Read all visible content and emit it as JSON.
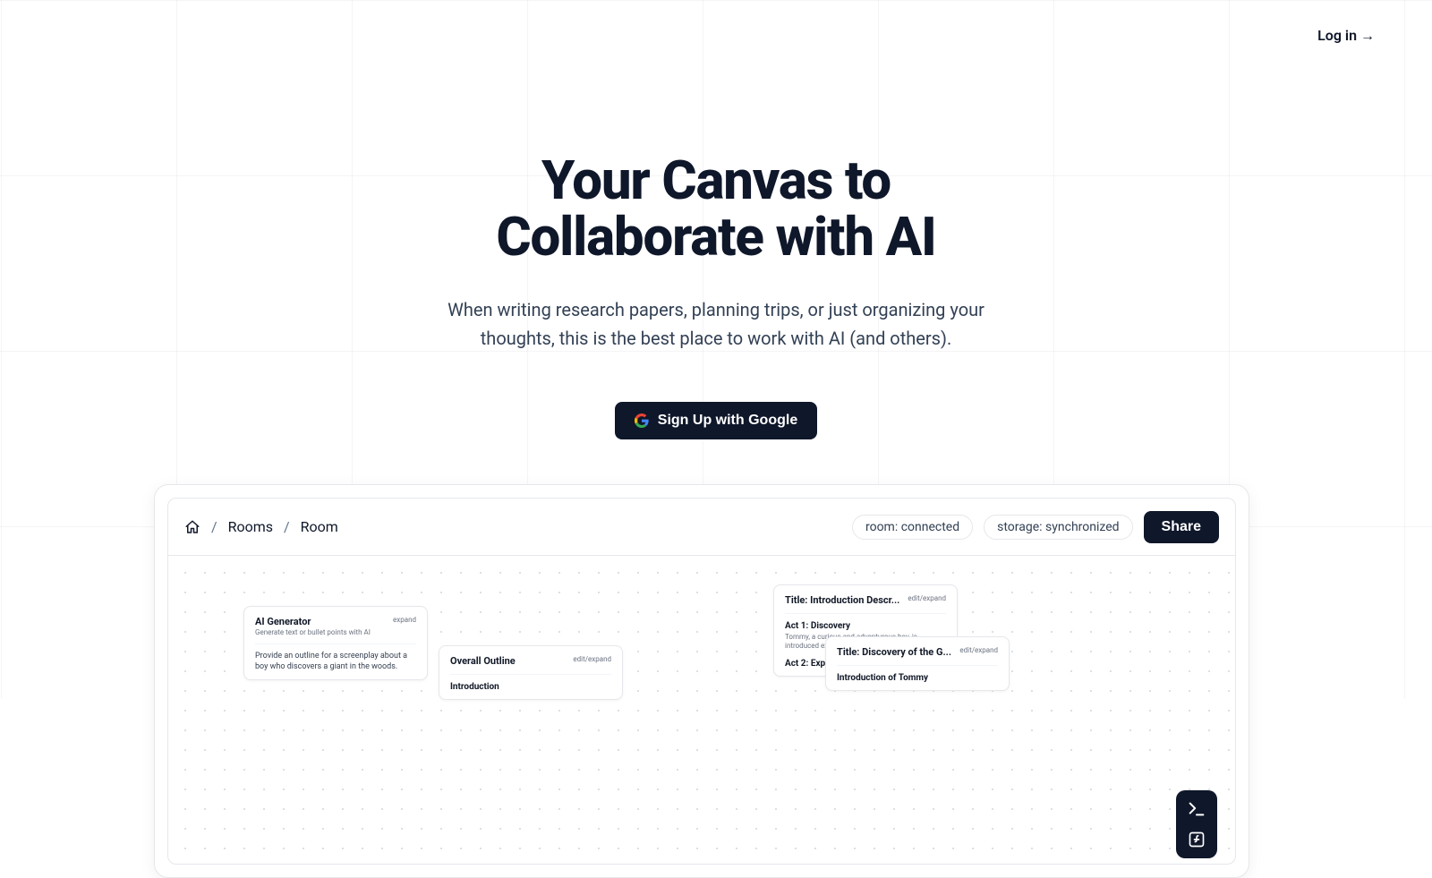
{
  "header": {
    "login_label": "Log in →"
  },
  "hero": {
    "headline": "Your Canvas to Collaborate with AI",
    "subtext": "When writing research papers, planning trips, or just organizing your thoughts, this is the best place to work with AI (and others).",
    "signup_label": "Sign Up with Google"
  },
  "app": {
    "breadcrumbs": {
      "rooms": "Rooms",
      "room": "Room"
    },
    "status": {
      "room": "room: connected",
      "storage": "storage: synchronized"
    },
    "share_label": "Share",
    "cards": {
      "ai_gen": {
        "title": "AI Generator",
        "subtitle": "Generate text or bullet points with AI",
        "action": "expand",
        "body": "Provide an outline for a screenplay about a boy who discovers a giant in the woods."
      },
      "outline": {
        "title": "Overall Outline",
        "action": "edit/expand",
        "section1": "Introduction"
      },
      "intro": {
        "title": "Title: Introduction Descr...",
        "action": "edit/expand",
        "act1_title": "Act 1: Discovery",
        "act1_body": "Tommy, a curious and adventurous boy, is introduced exploring th",
        "act2_title": "Act 2: Exp"
      },
      "discovery": {
        "title": "Title: Discovery of the G...",
        "action": "edit/expand",
        "section1": "Introduction of Tommy"
      }
    }
  }
}
